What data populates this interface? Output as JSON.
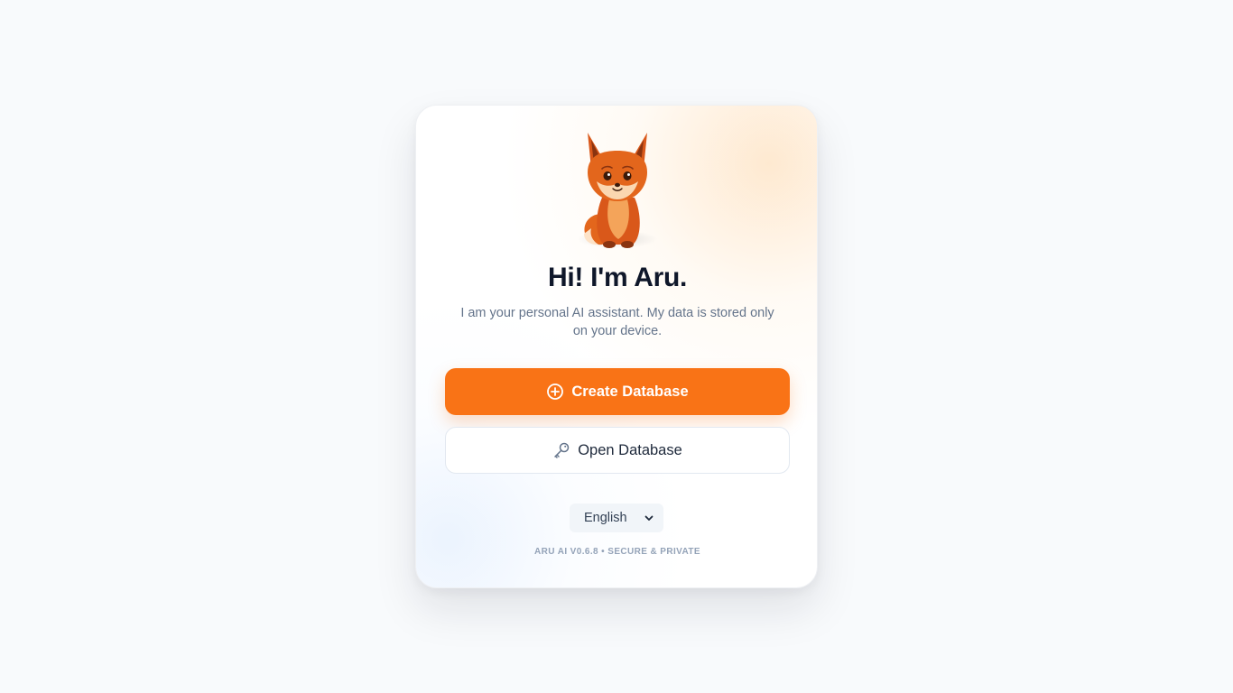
{
  "welcome": {
    "title": "Hi! I'm Aru.",
    "subtitle": "I am your personal AI assistant. My data is stored only on your device.",
    "mascot_icon": "fox-mascot-icon"
  },
  "actions": {
    "create_label": "Create Database",
    "create_icon": "plus-circle-icon",
    "open_label": "Open Database",
    "open_icon": "key-icon"
  },
  "language": {
    "selected": "English",
    "icon": "chevron-down-icon"
  },
  "footer": {
    "text": "ARU AI V0.6.8 • SECURE & PRIVATE"
  },
  "colors": {
    "accent": "#f97316",
    "background": "#f8fafc",
    "title": "#0f172a",
    "muted": "#64748b"
  }
}
